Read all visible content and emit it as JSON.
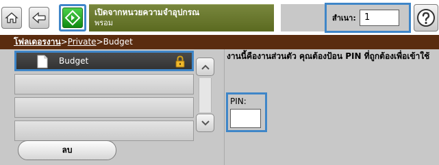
{
  "toolbar": {
    "home_icon": "home-icon",
    "back_icon": "back-arrow-icon",
    "start_icon": "start-diamond-icon",
    "help_icon": "help-icon"
  },
  "status": {
    "line1": "เปิดจากหนวยความจำอุปกรณ",
    "line2": "พรอม"
  },
  "copies": {
    "label": "สำเนา:",
    "value": "1"
  },
  "breadcrumb": {
    "folder_root": "โฟลเดอรงาน",
    "private": "Private",
    "current": "Budget",
    "separator": ">"
  },
  "list": {
    "items": [
      {
        "label": "Budget",
        "selected": true,
        "locked": true
      }
    ]
  },
  "delete_button": "ลบ",
  "message": "งานนี้คืองานส่วนตัว คุณต้องป้อน PIN ที่ถูกต้องเพื่อเข้าใช้",
  "pin": {
    "label": "PIN:",
    "value": ""
  },
  "colors": {
    "accent_blue": "#3f86c8",
    "status_green": "#5b6a20",
    "breadcrumb_brown": "#5a2c0f",
    "panel_gray": "#c8c8c8"
  }
}
